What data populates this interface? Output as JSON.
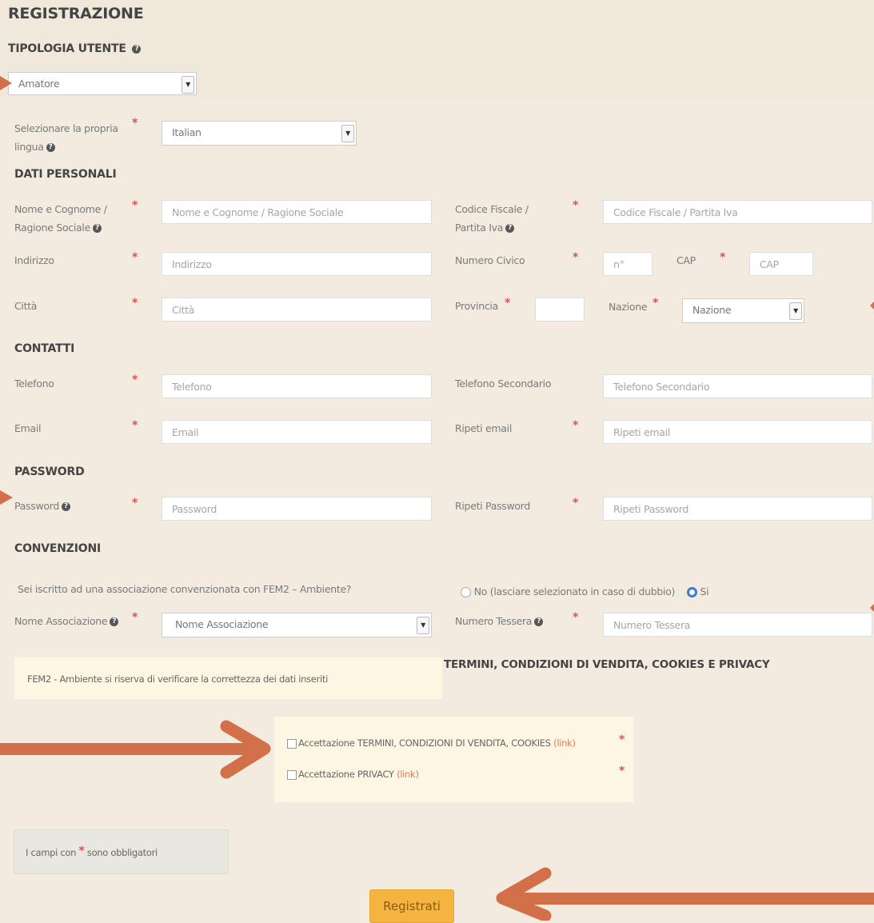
{
  "page": {
    "title": "REGISTRAZIONE",
    "user_type_heading": "TIPOLOGIA UTENTE",
    "user_type_value": "Amatore"
  },
  "language": {
    "label_line1": "Selezionare la propria",
    "label_line2": "lingua",
    "value": "Italian"
  },
  "personal": {
    "heading": "DATI PERSONALI",
    "name_label_1": "Nome e Cognome /",
    "name_label_2": "Ragione Sociale",
    "name_placeholder": "Nome e Cognome / Ragione Sociale",
    "cf_label_1": "Codice Fiscale /",
    "cf_label_2": "Partita Iva",
    "cf_placeholder": "Codice Fiscale / Partita Iva",
    "address_label": "Indirizzo",
    "address_placeholder": "Indirizzo",
    "civic_label": "Numero Civico",
    "civic_placeholder": "n°",
    "cap_label": "CAP",
    "cap_placeholder": "CAP",
    "city_label": "Città",
    "city_placeholder": "Città",
    "province_label": "Provincia",
    "nation_label": "Nazione",
    "nation_value": "Nazione"
  },
  "contacts": {
    "heading": "CONTATTI",
    "phone_label": "Telefono",
    "phone_placeholder": "Telefono",
    "phone2_label": "Telefono Secondario",
    "phone2_placeholder": "Telefono Secondario",
    "email_label": "Email",
    "email_placeholder": "Email",
    "email2_label": "Ripeti email",
    "email2_placeholder": "Ripeti email"
  },
  "password": {
    "heading": "PASSWORD",
    "pw_label": "Password",
    "pw_placeholder": "Password",
    "pw2_label": "Ripeti Password",
    "pw2_placeholder": "Ripeti Password"
  },
  "conventions": {
    "heading": "CONVENZIONI",
    "question": "Sei iscritto ad una associazione convenzionata con FEM2 – Ambiente?",
    "option_no": "No (lasciare selezionato in caso di dubbio)",
    "option_yes": "Si",
    "assoc_label": "Nome Associazione",
    "assoc_value": "Nome Associazione",
    "card_label": "Numero Tessera",
    "card_placeholder": "Numero Tessera"
  },
  "notice": {
    "text": "FEM2 - Ambiente si riserva di verificare la correttezza dei dati inseriti"
  },
  "terms": {
    "heading": "TERMINI, CONDIZIONI DI VENDITA, COOKIES E PRIVACY",
    "accept_terms": "Accettazione TERMINI, CONDIZIONI DI VENDITA, COOKIES",
    "accept_privacy": "Accettazione PRIVACY",
    "link_text": "(link)"
  },
  "required_note": {
    "prefix": "I campi con",
    "suffix": "sono obbligatori"
  },
  "submit": {
    "label": "Registrati"
  },
  "colors": {
    "background": "#f3ebdf",
    "required": "#d9534f",
    "button": "#f5b342",
    "arrow": "#d2704a",
    "radio_on": "#3a7bd5"
  }
}
